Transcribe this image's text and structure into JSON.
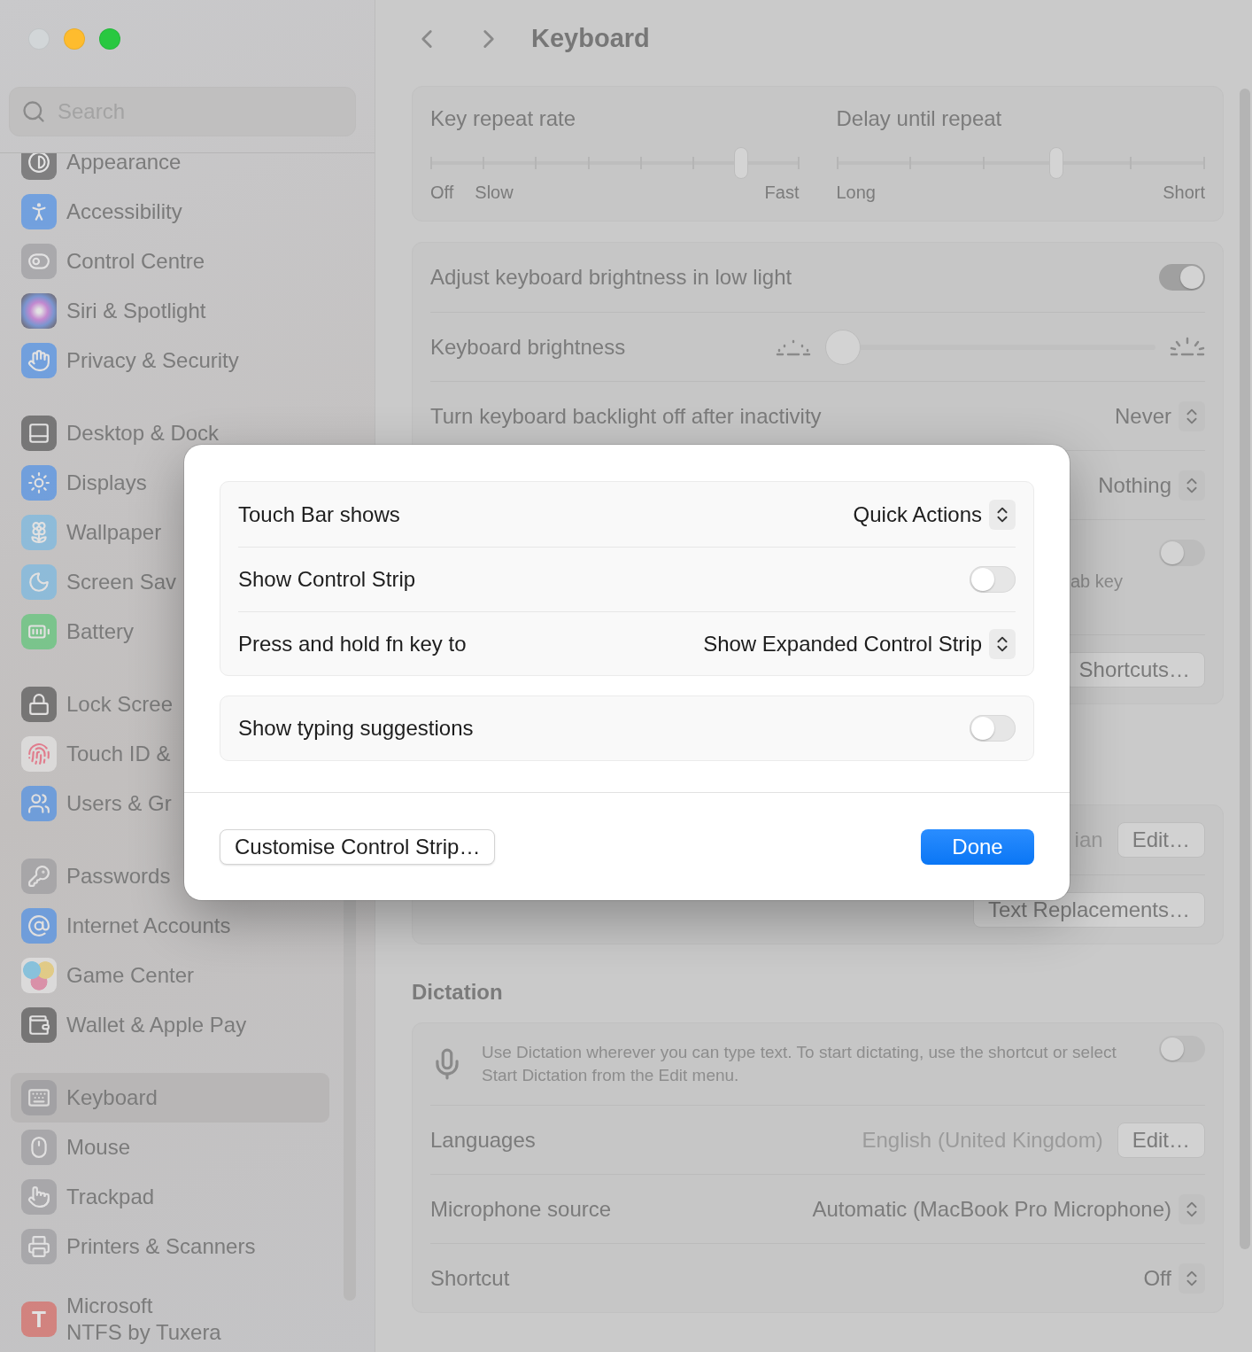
{
  "sidebar": {
    "search": {
      "placeholder": "Search"
    },
    "groups": [
      {
        "items": [
          {
            "label": "Appearance",
            "selected": false
          },
          {
            "label": "Accessibility",
            "selected": false
          },
          {
            "label": "Control Centre",
            "selected": false
          },
          {
            "label": "Siri & Spotlight",
            "selected": false
          },
          {
            "label": "Privacy & Security",
            "selected": false
          }
        ]
      },
      {
        "items": [
          {
            "label": "Desktop & Dock",
            "selected": false
          },
          {
            "label": "Displays",
            "selected": false
          },
          {
            "label": "Wallpaper",
            "selected": false
          },
          {
            "label": "Screen Sav",
            "selected": false
          },
          {
            "label": "Battery",
            "selected": false
          }
        ]
      },
      {
        "items": [
          {
            "label": "Lock Scree",
            "selected": false
          },
          {
            "label": "Touch ID &",
            "selected": false
          },
          {
            "label": "Users & Gr",
            "selected": false
          }
        ]
      },
      {
        "items": [
          {
            "label": "Passwords",
            "selected": false
          },
          {
            "label": "Internet Accounts",
            "selected": false
          },
          {
            "label": "Game Center",
            "selected": false
          },
          {
            "label": "Wallet & Apple Pay",
            "selected": false
          }
        ]
      },
      {
        "items": [
          {
            "label": "Keyboard",
            "selected": true
          },
          {
            "label": "Mouse",
            "selected": false
          },
          {
            "label": "Trackpad",
            "selected": false
          },
          {
            "label": "Printers & Scanners",
            "selected": false
          }
        ]
      },
      {
        "items": [
          {
            "label": "Microsoft\nNTFS by Tuxera",
            "selected": false,
            "logo": "T"
          }
        ]
      }
    ]
  },
  "toolbar": {
    "title": "Keyboard"
  },
  "repeat_card": {
    "sliders": [
      {
        "label": "Key repeat rate",
        "level": 0.857,
        "labels": [
          "Off",
          "Slow",
          "Fast"
        ]
      },
      {
        "label": "Delay until repeat",
        "level": 0.6,
        "labels": [
          "Long",
          "Short"
        ]
      }
    ]
  },
  "backlight_card": {
    "rows": [
      {
        "kind": "toggle",
        "label": "Adjust keyboard brightness in low light",
        "on": true
      },
      {
        "kind": "slider",
        "label": "Keyboard brightness",
        "level": 0
      },
      {
        "kind": "select",
        "label": "Turn keyboard backlight off after inactivity",
        "value": "Never"
      },
      {
        "kind": "select",
        "value": "Nothing"
      },
      {
        "kind": "toggle",
        "on": false,
        "note": "ab key"
      },
      {
        "kind": "button",
        "button": "Shortcuts…"
      }
    ]
  },
  "input_card": {
    "rows": [
      {
        "kind": "button",
        "value": "ian",
        "button": "Edit…"
      },
      {
        "kind": "button",
        "button": "Text Replacements…"
      }
    ]
  },
  "dictation": {
    "heading": "Dictation",
    "description": "Use Dictation wherever you can type text. To start dictating, use the shortcut or select Start Dictation from the Edit menu.",
    "on": false,
    "rows": [
      {
        "kind": "button",
        "label": "Languages",
        "value": "English (United Kingdom)",
        "button": "Edit…"
      },
      {
        "kind": "select",
        "label": "Microphone source",
        "value": "Automatic (MacBook Pro Microphone)"
      },
      {
        "kind": "select",
        "label": "Shortcut",
        "value": "Off"
      }
    ]
  },
  "sheet": {
    "groups": [
      {
        "rows": [
          {
            "kind": "select",
            "label": "Touch Bar shows",
            "value": "Quick Actions"
          },
          {
            "kind": "toggle",
            "label": "Show Control Strip",
            "on": false
          },
          {
            "kind": "select",
            "label": "Press and hold fn key to",
            "value": "Show Expanded Control Strip"
          }
        ]
      },
      {
        "rows": [
          {
            "kind": "toggle",
            "label": "Show typing suggestions",
            "on": false
          }
        ]
      }
    ],
    "buttons": [
      {
        "kind": "secondary",
        "label": "Customise Control Strip…"
      },
      {
        "kind": "primary",
        "label": "Done"
      }
    ]
  }
}
